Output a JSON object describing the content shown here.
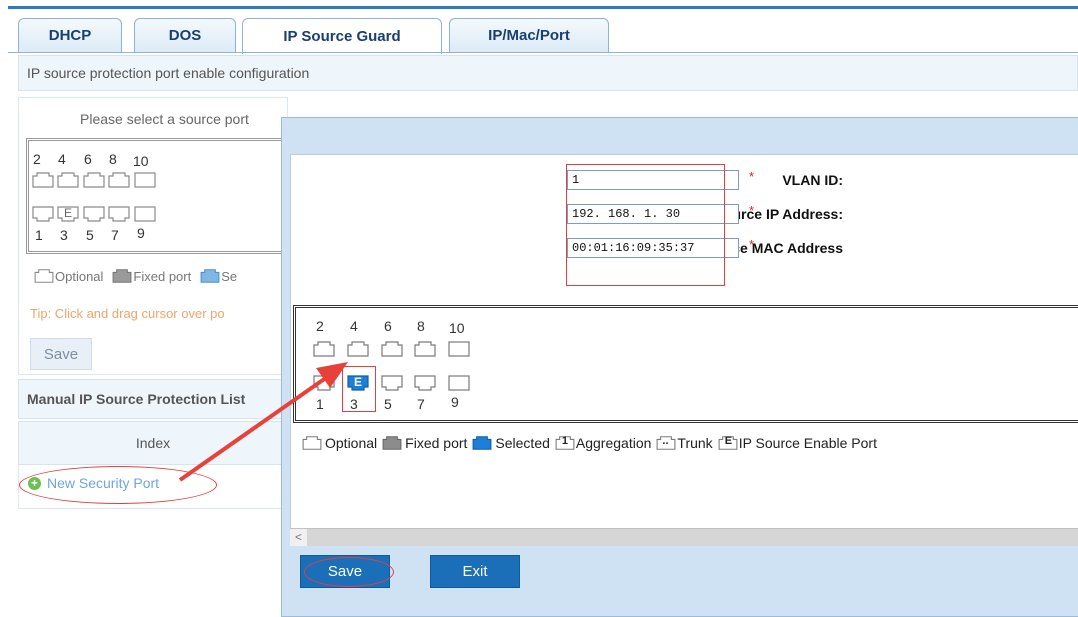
{
  "tabs": [
    {
      "label": "DHCP"
    },
    {
      "label": "DOS"
    },
    {
      "label": "IP Source Guard",
      "active": true
    },
    {
      "label": "IP/Mac/Port"
    }
  ],
  "section_title": "IP source protection port enable configuration",
  "left_panel": {
    "prompt": "Please select a source port",
    "top_port_numbers": [
      "2",
      "4",
      "6",
      "8",
      "10"
    ],
    "bottom_port_numbers": [
      "1",
      "3",
      "5",
      "7",
      "9"
    ],
    "port3_mark": "E",
    "legend_optional": "Optional",
    "legend_fixed": "Fixed port",
    "legend_selected_partial": "Se",
    "tip": "Tip:  Click and drag cursor over po",
    "save_label": "Save",
    "manual_list_title": "Manual IP Source Protection List",
    "index_header": "Index",
    "new_port_label": "New Security Port"
  },
  "dialog": {
    "vlan_label": "VLAN ID:",
    "vlan_value": "1",
    "ip_label": "Source IP Address:",
    "ip_value": "192. 168. 1. 30",
    "mac_label": "Source MAC Address",
    "mac_value": "00:01:16:09:35:37",
    "required_mark": "*",
    "top_port_numbers": [
      "2",
      "4",
      "6",
      "8",
      "10"
    ],
    "bottom_port_numbers": [
      "1",
      "3",
      "5",
      "7",
      "9"
    ],
    "selected_port_mark": "E",
    "legend": {
      "optional": "Optional",
      "fixed": "Fixed port",
      "selected": "Selected",
      "aggregation_mark": "1",
      "aggregation": "Aggregation",
      "trunk_mark": "..",
      "trunk": "Trunk",
      "ipsource_mark": "E",
      "ipsource": "IP Source Enable Port"
    },
    "save_label": "Save",
    "exit_label": "Exit",
    "scroll_left_glyph": "<"
  },
  "colors": {
    "accent": "#2f79c2",
    "button_blue": "#1a6fb8",
    "annotation_red": "#e04040",
    "selected_port": "#1e7fd6"
  },
  "icons": {
    "port": "ethernet-port-icon",
    "add": "plus-circle-icon"
  }
}
